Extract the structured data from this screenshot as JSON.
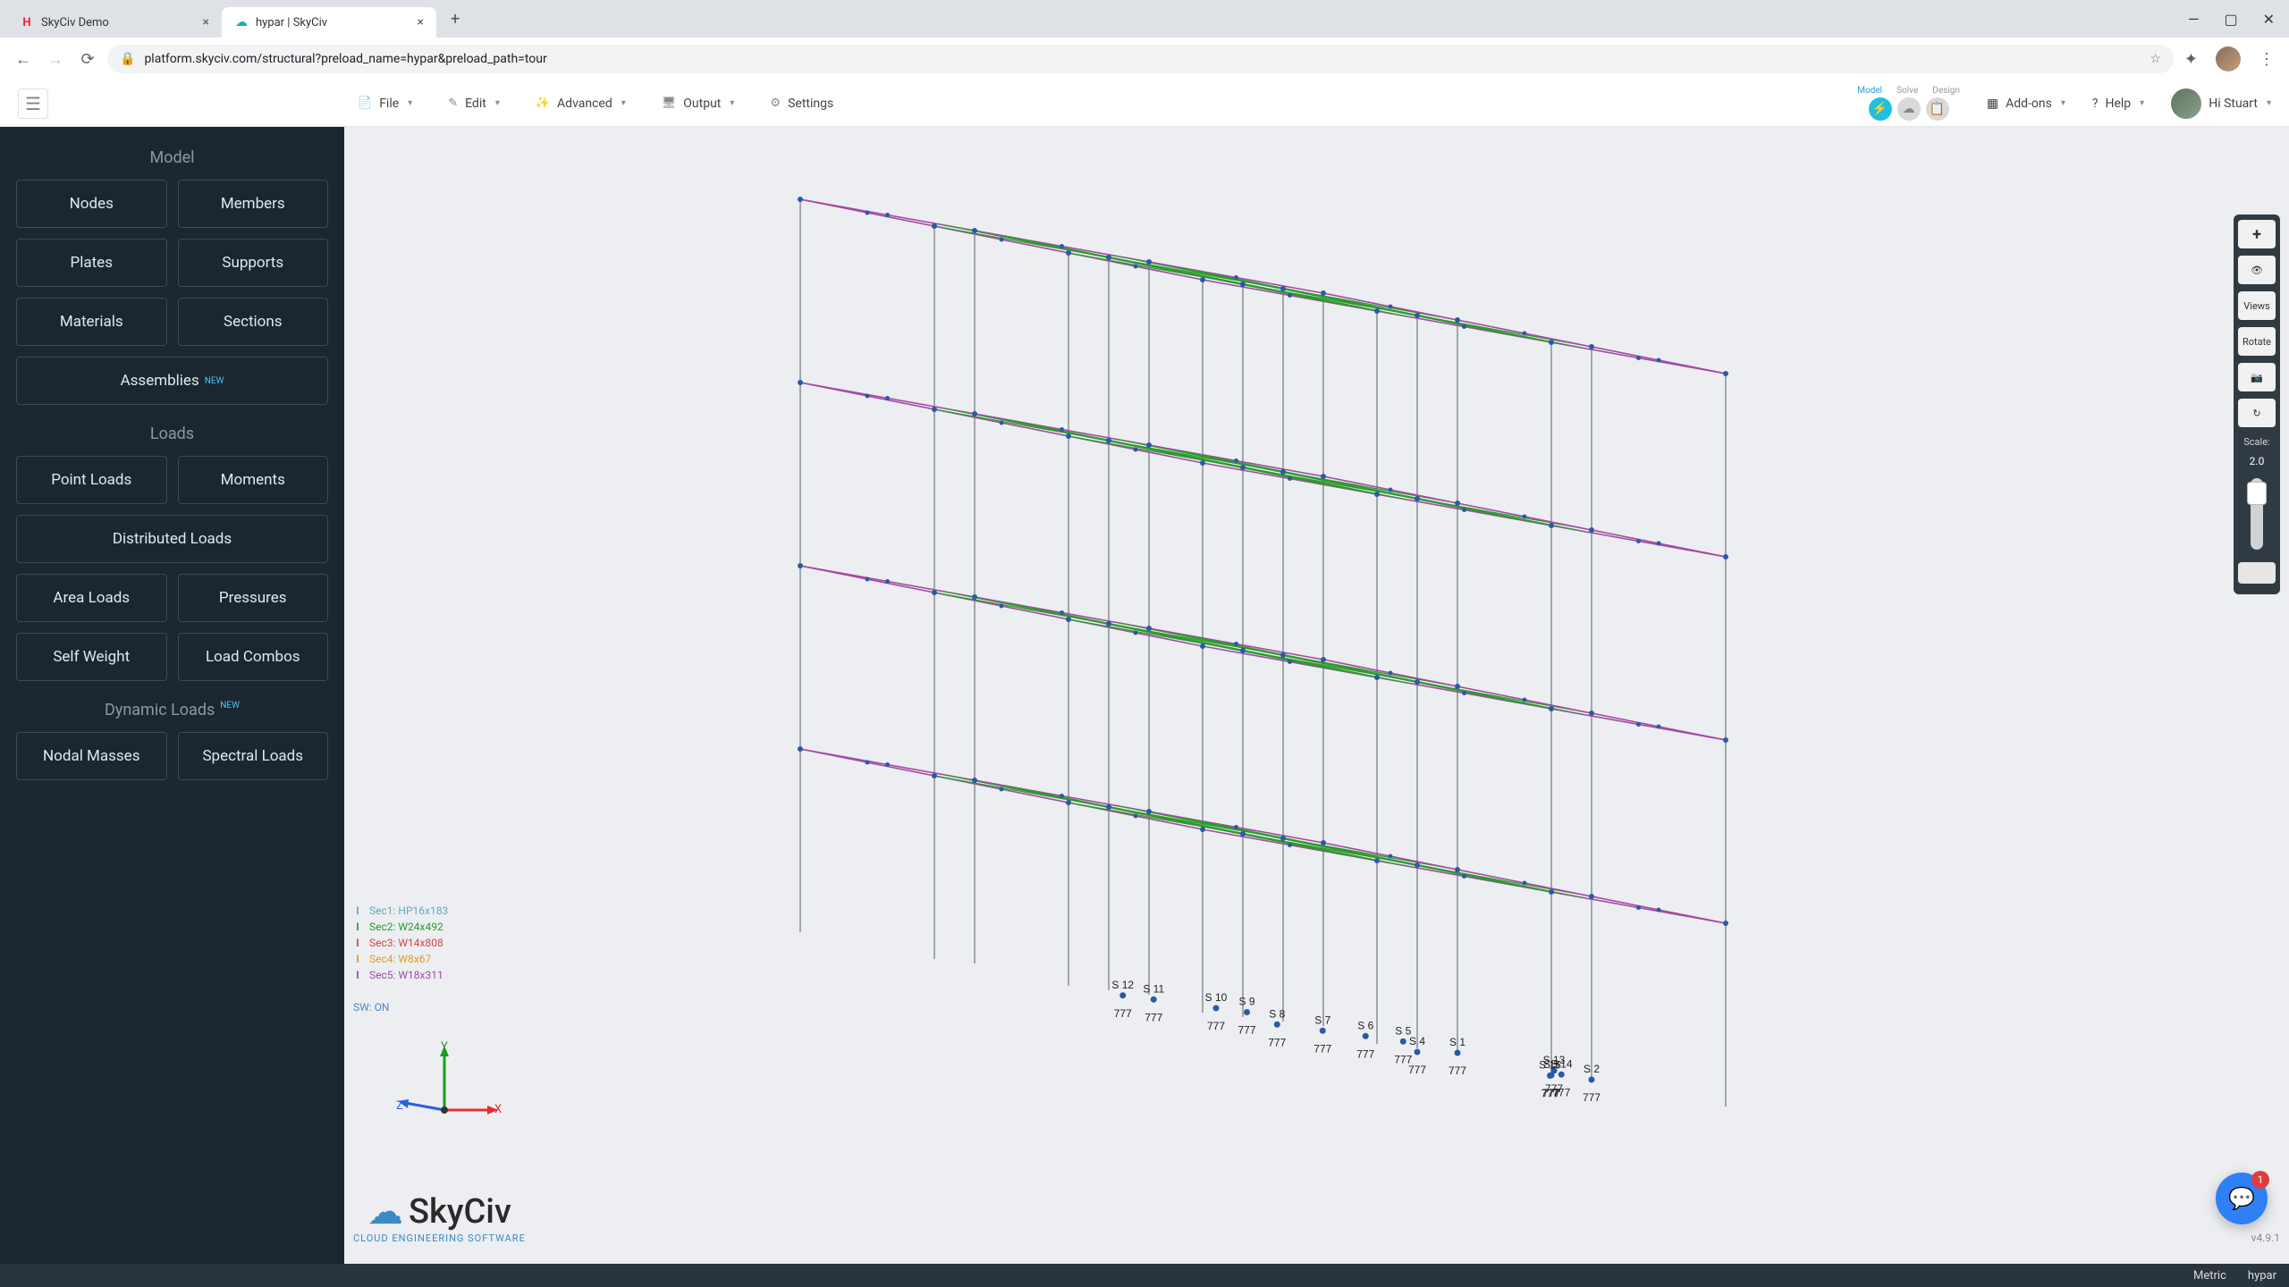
{
  "browser": {
    "tabs": [
      {
        "title": "SkyCiv Demo",
        "active": false,
        "icon": "H",
        "icon_color": "#e23"
      },
      {
        "title": "hypar | SkyCiv",
        "active": true,
        "icon": "☁",
        "icon_color": "#5aa"
      }
    ],
    "url": "platform.skyciv.com/structural?preload_name=hypar&preload_path=tour"
  },
  "header": {
    "menu": {
      "file": "File",
      "edit": "Edit",
      "advanced": "Advanced",
      "output": "Output",
      "settings": "Settings"
    },
    "msd": {
      "model": "Model",
      "solve": "Solve",
      "design": "Design"
    },
    "addons": "Add-ons",
    "help": "Help",
    "greeting": "Hi Stuart"
  },
  "sidebar": {
    "model": {
      "header": "Model",
      "nodes": "Nodes",
      "members": "Members",
      "plates": "Plates",
      "supports": "Supports",
      "materials": "Materials",
      "sections": "Sections",
      "assemblies": "Assemblies"
    },
    "loads": {
      "header": "Loads",
      "point": "Point Loads",
      "moments": "Moments",
      "distributed": "Distributed Loads",
      "area": "Area Loads",
      "pressures": "Pressures",
      "selfweight": "Self Weight",
      "combos": "Load Combos"
    },
    "dyn": {
      "header": "Dynamic Loads",
      "nodal": "Nodal Masses",
      "spectral": "Spectral Loads"
    },
    "new_badge": "NEW"
  },
  "legend": [
    {
      "color": "#6aa7b8",
      "label": "Sec1: HP16x183"
    },
    {
      "color": "#2e9a2e",
      "label": "Sec2: W24x492"
    },
    {
      "color": "#d04848",
      "label": "Sec3: W14x808"
    },
    {
      "color": "#d8a028",
      "label": "Sec4: W8x67"
    },
    {
      "color": "#a34aa3",
      "label": "Sec5: W18x311"
    }
  ],
  "sw_label": "SW: ON",
  "axis": {
    "x": "X",
    "y": "Y",
    "z": "Z"
  },
  "logo": {
    "brand": "SkyCiv",
    "tagline": "CLOUD ENGINEERING SOFTWARE"
  },
  "version": "v4.9.1",
  "right_rail": {
    "plus": "+",
    "eye": "👁",
    "views": "Views",
    "rotate": "Rotate",
    "camera": "📷",
    "loop": "↻",
    "scale_label": "Scale:",
    "scale_value": "2.0"
  },
  "support_labels": [
    "S 1",
    "S 2",
    "S 3",
    "S 4",
    "S 5",
    "S 6",
    "S 7",
    "S 8",
    "S 9",
    "S 10",
    "S 11",
    "S 12",
    "S 13",
    "S 14",
    "S 15"
  ],
  "support_sym": "777",
  "bottom": {
    "units": "Metric",
    "platform": "hypar"
  },
  "chat": {
    "badge": "1"
  }
}
